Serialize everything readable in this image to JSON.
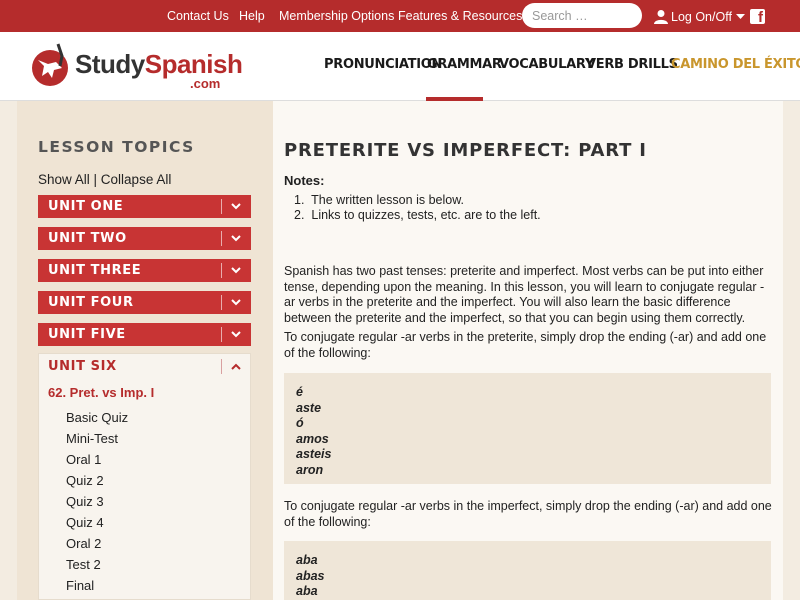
{
  "topbar": {
    "links": [
      "Contact Us",
      "Help",
      "Membership Options",
      "Features & Resources"
    ],
    "search_placeholder": "Search …",
    "login_label": "Log On/Off"
  },
  "logo": {
    "study": "Study",
    "spanish": "Spanish",
    "com": ".com"
  },
  "nav": [
    "PRONUNCIATION",
    "GRAMMAR",
    "VOCABULARY",
    "VERB DRILLS",
    "CAMINO DEL ÉXITO"
  ],
  "sidebar": {
    "heading": "LESSON TOPICS",
    "show_all": "Show All",
    "collapse_all": "Collapse All",
    "units": [
      "UNIT ONE",
      "UNIT TWO",
      "UNIT THREE",
      "UNIT FOUR",
      "UNIT FIVE"
    ],
    "open_unit": "UNIT SIX",
    "lesson": "62. Pret. vs Imp. I",
    "sub_items": [
      "Basic Quiz",
      "Mini-Test",
      "Oral 1",
      "Quiz 2",
      "Quiz 3",
      "Quiz 4",
      "Oral 2",
      "Test 2",
      "Final"
    ]
  },
  "content": {
    "title": "PRETERITE VS IMPERFECT: PART I",
    "notes_heading": "Notes:",
    "notes": [
      "The written lesson is below.",
      "Links to quizzes, tests, etc. are to the left."
    ],
    "para1": "Spanish has two past tenses: preterite and imperfect. Most verbs can be put into either tense, depending upon the meaning. In this lesson, you will learn to conjugate regular -ar verbs in the preterite and the imperfect. You will also learn the basic difference between the preterite and the imperfect, so that you can begin using them correctly.",
    "para2": "To conjugate regular -ar verbs in the preterite, simply drop the ending (-ar) and add one of the following:",
    "preterite_endings": [
      "é",
      "aste",
      "ó",
      "amos",
      "asteis",
      "aron"
    ],
    "para3": "To conjugate regular -ar verbs in the imperfect, simply drop the ending (-ar) and add one of the following:",
    "imperfect_endings": [
      "aba",
      "abas",
      "aba"
    ]
  },
  "colors": {
    "brand_red": "#b52c2c",
    "unit_red": "#c83434",
    "accent_gold": "#c9962d"
  }
}
